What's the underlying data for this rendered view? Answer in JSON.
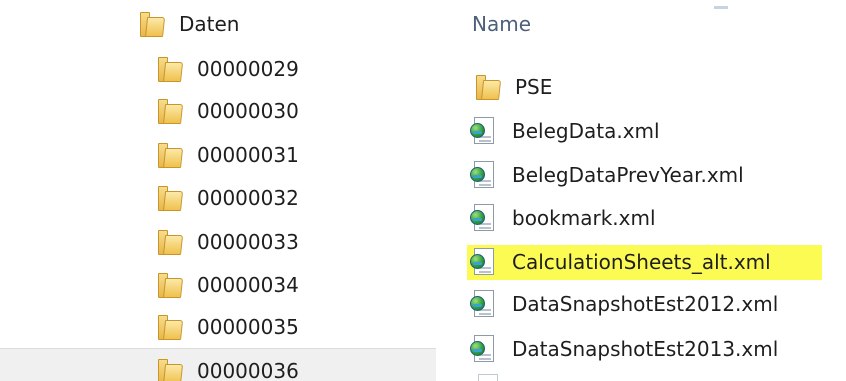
{
  "tree": {
    "parent": {
      "label": "Daten",
      "icon": "folder-icon"
    },
    "children": [
      {
        "label": "00000029",
        "icon": "folder-icon"
      },
      {
        "label": "00000030",
        "icon": "folder-icon"
      },
      {
        "label": "00000031",
        "icon": "folder-icon"
      },
      {
        "label": "00000032",
        "icon": "folder-icon"
      },
      {
        "label": "00000033",
        "icon": "folder-icon"
      },
      {
        "label": "00000034",
        "icon": "folder-icon"
      },
      {
        "label": "00000035",
        "icon": "folder-icon"
      },
      {
        "label": "00000036",
        "icon": "folder-icon"
      }
    ]
  },
  "file_list": {
    "column_header": "Name",
    "items": [
      {
        "label": "PSE",
        "icon": "folder-icon"
      },
      {
        "label": "BelegData.xml",
        "icon": "xml-file-icon"
      },
      {
        "label": "BelegDataPrevYear.xml",
        "icon": "xml-file-icon"
      },
      {
        "label": "bookmark.xml",
        "icon": "xml-file-icon"
      },
      {
        "label": "CalculationSheets_alt.xml",
        "icon": "xml-file-icon",
        "highlighted": true
      },
      {
        "label": "DataSnapshotEst2012.xml",
        "icon": "xml-file-icon"
      },
      {
        "label": "DataSnapshotEst2013.xml",
        "icon": "xml-file-icon"
      }
    ]
  },
  "colors": {
    "highlight": "#fbfb54",
    "folder": "#f0c14e",
    "header_text": "#4c607a"
  }
}
